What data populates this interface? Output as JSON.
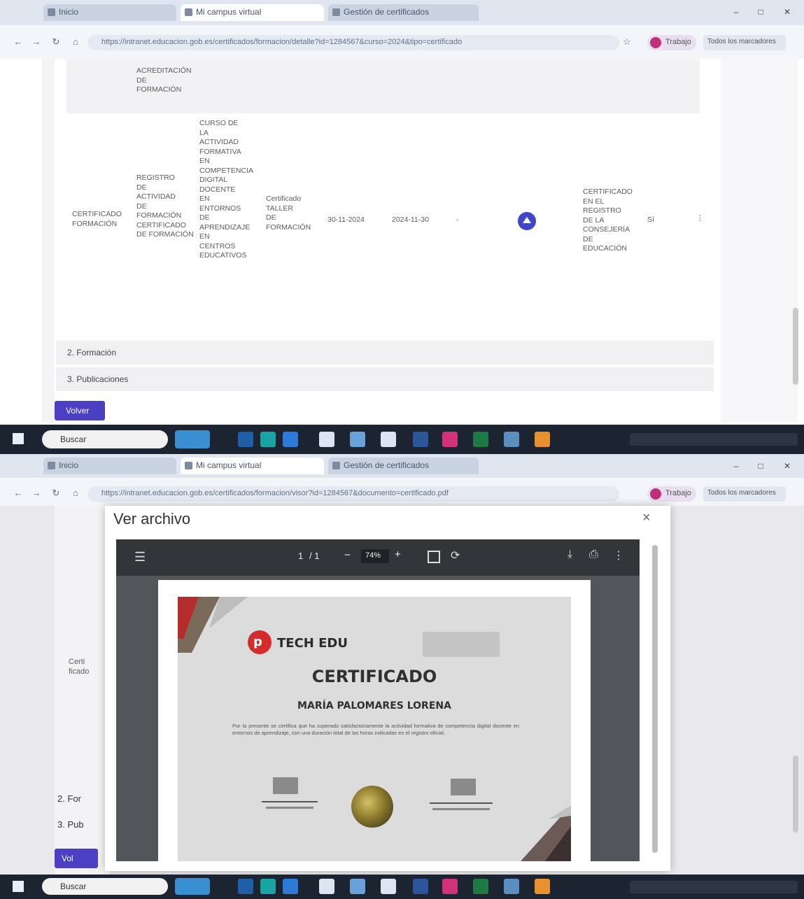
{
  "top_browser": {
    "tabs": [
      {
        "label": "Inicio"
      },
      {
        "label": "Mi campus virtual"
      },
      {
        "label": "Gestión de certificados"
      }
    ],
    "url": "https://intranet.educacion.gob.es/certificados/formacion/detalle?id=1284567&curso=2024&tipo=certificado",
    "profile_label": "Trabajo",
    "bookmarks_label": "Todos los marcadores",
    "window_controls": {
      "minimize": "–",
      "maximize": "□",
      "close": "✕"
    }
  },
  "table": {
    "prev_row_tail": [
      "ACREDITACIÓN",
      "DE",
      "FORMACIÓN"
    ],
    "row": {
      "owner": [
        "CERTIFICADO",
        "FORMACIÓN"
      ],
      "type": [
        "REGISTRO",
        "DE",
        "ACTIVIDAD",
        "DE",
        "FORMACIÓN",
        "CERTIFICADO",
        "DE FORMACIÓN"
      ],
      "description": [
        "CURSO DE",
        "LA",
        "ACTIVIDAD",
        "FORMATIVA",
        "EN",
        "COMPETENCIA",
        "DIGITAL",
        "DOCENTE",
        "EN",
        "ENTORNOS",
        "DE",
        "APRENDIZAJE",
        "EN",
        "CENTROS",
        "EDUCATIVOS"
      ],
      "hours": [
        "Certificado",
        "TALLER",
        "DE",
        "FORMACIÓN"
      ],
      "date1": "30-11-2024",
      "date2": "2024-11-30",
      "dash": "-",
      "status": [
        "CERTIFICADO",
        "EN EL",
        "REGISTRO",
        "DE LA",
        "CONSEJERÍA",
        "DE",
        "EDUCACIÓN"
      ],
      "extra": "Sí"
    }
  },
  "accordions": [
    {
      "label": "2. Formación"
    },
    {
      "label": "3. Publicaciones"
    }
  ],
  "footer_button": "Volver",
  "taskbar": {
    "search_placeholder": "Buscar",
    "icons": [
      "file-explorer-icon",
      "edge-icon",
      "store-icon",
      "mail-icon",
      "photos-icon",
      "office-icon",
      "word-icon",
      "excel-icon",
      "powerpoint-icon",
      "files-icon"
    ]
  },
  "bottom_browser": {
    "tabs": [
      {
        "label": "Inicio"
      },
      {
        "label": "Mi campus virtual"
      },
      {
        "label": "Gestión de certificados"
      }
    ],
    "url": "https://intranet.educacion.gob.es/certificados/formacion/visor?id=1284567&documento=certificado.pdf"
  },
  "modal": {
    "title": "Ver archivo",
    "close": "×",
    "pdf_toolbar": {
      "page": "1",
      "total": "/ 1",
      "zoom": "74%"
    },
    "certificate": {
      "brand": "TECH EDU",
      "heading": "CERTIFICADO",
      "name": "MARÍA PALOMARES LORENA",
      "body": "Por la presente se certifica que ha superado satisfactoriamente la actividad formativa de competencia digital docente en entornos de aprendizaje, con una duración total de las horas indicadas en el registro oficial."
    },
    "side_text": [
      "Certi",
      "ficado"
    ],
    "side_accordions": [
      "2. For",
      "3. Pub"
    ],
    "side_button": "Vol"
  }
}
